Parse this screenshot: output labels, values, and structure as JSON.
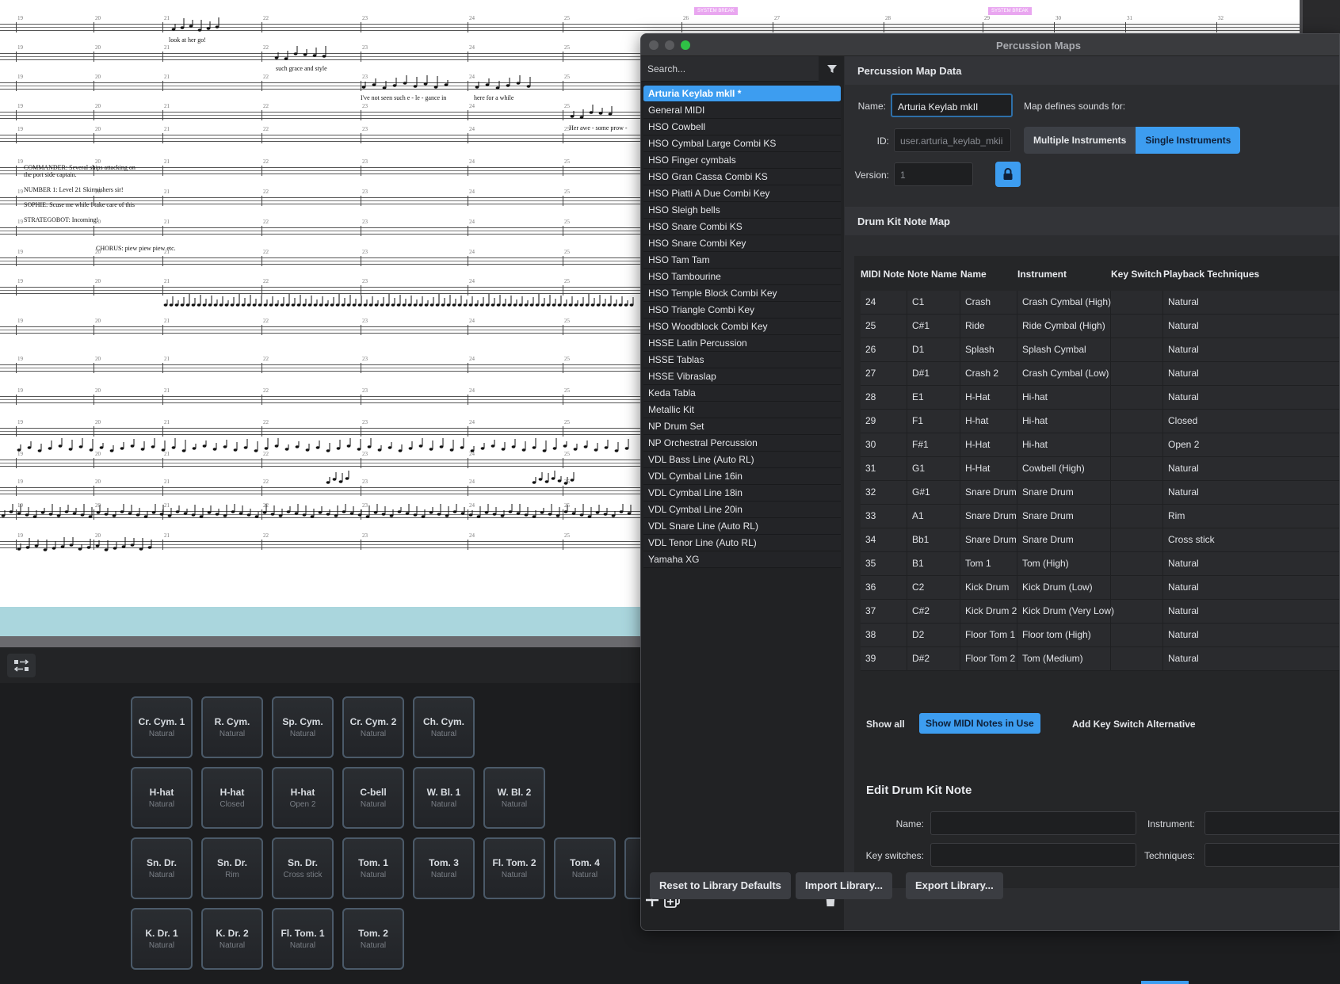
{
  "score": {
    "system_break_label": "SYSTEM BREAK",
    "lyrics": [
      "look at her go!",
      "such grace and style",
      "I've not seen such e - le - gance in",
      "here for a while",
      "Her awe - some prow -",
      "COMMANDER: Several ships attacking on",
      "the port side captain.",
      "NUMBER 1: Level 21 Skirmishers sir!",
      "SOPHIE: Scuse me while I take care of this",
      "STRATEGOBOT: Incoming!",
      "CHORUS: piew piew piew etc."
    ],
    "bar_numbers": [
      "19",
      "20",
      "21",
      "22",
      "23",
      "24",
      "25",
      "26",
      "27",
      "28",
      "29",
      "30",
      "31",
      "32"
    ]
  },
  "dialog": {
    "title": "Percussion Maps",
    "search_placeholder": "Search...",
    "maps": [
      "Arturia Keylab mkII *",
      "General MIDI",
      "HSO Cowbell",
      "HSO Cymbal Large Combi KS",
      "HSO Finger cymbals",
      "HSO Gran Cassa Combi KS",
      "HSO Piatti A Due Combi Key",
      "HSO Sleigh bells",
      "HSO Snare Combi KS",
      "HSO Snare Combi Key",
      "HSO Tam Tam",
      "HSO Tambourine",
      "HSO Temple Block Combi Key",
      "HSO Triangle Combi Key",
      "HSO Woodblock Combi Key",
      "HSSE Latin Percussion",
      "HSSE Tablas",
      "HSSE Vibraslap",
      "Keda Tabla",
      "Metallic Kit",
      "NP Drum Set",
      "NP Orchestral Percussion",
      "VDL Bass Line (Auto RL)",
      "VDL Cymbal Line 16in",
      "VDL Cymbal Line 18in",
      "VDL Cymbal Line 20in",
      "VDL Snare Line (Auto RL)",
      "VDL Tenor Line (Auto RL)",
      "Yamaha XG"
    ],
    "data_section": {
      "heading": "Percussion Map Data",
      "name_label": "Name:",
      "name_value": "Arturia Keylab mkII",
      "id_label": "ID:",
      "id_value": "user.arturia_keylab_mkii",
      "version_label": "Version:",
      "version_value": "1",
      "defines_label": "Map defines sounds for:",
      "multiple_label": "Multiple Instruments",
      "single_label": "Single Instruments"
    },
    "note_map": {
      "heading": "Drum Kit Note Map",
      "columns": [
        "MIDI Note",
        "Note Name",
        "Name",
        "Instrument",
        "Key Switch",
        "Playback Techniques"
      ],
      "rows": [
        [
          "24",
          "C1",
          "Crash",
          "Crash Cymbal (High)",
          "",
          "Natural"
        ],
        [
          "25",
          "C#1",
          "Ride",
          "Ride Cymbal (High)",
          "",
          "Natural"
        ],
        [
          "26",
          "D1",
          "Splash",
          "Splash Cymbal",
          "",
          "Natural"
        ],
        [
          "27",
          "D#1",
          "Crash 2",
          "Crash Cymbal (Low)",
          "",
          "Natural"
        ],
        [
          "28",
          "E1",
          "H-Hat",
          "Hi-hat",
          "",
          "Natural"
        ],
        [
          "29",
          "F1",
          "H-hat",
          "Hi-hat",
          "",
          "Closed"
        ],
        [
          "30",
          "F#1",
          "H-Hat",
          "Hi-hat",
          "",
          "Open 2"
        ],
        [
          "31",
          "G1",
          "H-Hat",
          "Cowbell (High)",
          "",
          "Natural"
        ],
        [
          "32",
          "G#1",
          "Snare Drum",
          "Snare Drum",
          "",
          "Natural"
        ],
        [
          "33",
          "A1",
          "Snare Drum",
          "Snare Drum",
          "",
          "Rim"
        ],
        [
          "34",
          "Bb1",
          "Snare Drum",
          "Snare Drum",
          "",
          "Cross stick"
        ],
        [
          "35",
          "B1",
          "Tom 1",
          "Tom (High)",
          "",
          "Natural"
        ],
        [
          "36",
          "C2",
          "Kick Drum",
          "Kick Drum (Low)",
          "",
          "Natural"
        ],
        [
          "37",
          "C#2",
          "Kick Drum 2",
          "Kick Drum (Very Low)",
          "",
          "Natural"
        ],
        [
          "38",
          "D2",
          "Floor Tom 1",
          "Floor tom (High)",
          "",
          "Natural"
        ],
        [
          "39",
          "D#2",
          "Floor Tom 2",
          "Tom (Medium)",
          "",
          "Natural"
        ]
      ],
      "show_all": "Show all",
      "show_in_use": "Show MIDI Notes in Use",
      "add_key_switch": "Add Key Switch Alternative"
    },
    "edit_section": {
      "heading": "Edit Drum Kit Note",
      "name_label": "Name:",
      "instrument_label": "Instrument:",
      "key_switches_label": "Key switches:",
      "techniques_label": "Techniques:"
    },
    "buttons": {
      "reset": "Reset to Library Defaults",
      "import": "Import Library...",
      "export": "Export Library..."
    }
  },
  "pads": [
    {
      "label": "Cr. Cym. 1",
      "tech": "Natural"
    },
    {
      "label": "R. Cym.",
      "tech": "Natural"
    },
    {
      "label": "Sp. Cym.",
      "tech": "Natural"
    },
    {
      "label": "Cr. Cym. 2",
      "tech": "Natural"
    },
    {
      "label": "Ch. Cym.",
      "tech": "Natural"
    },
    {
      "label": "H-hat",
      "tech": "Natural"
    },
    {
      "label": "H-hat",
      "tech": "Closed"
    },
    {
      "label": "H-hat",
      "tech": "Open 2"
    },
    {
      "label": "C-bell",
      "tech": "Natural"
    },
    {
      "label": "W. Bl. 1",
      "tech": "Natural"
    },
    {
      "label": "W. Bl. 2",
      "tech": "Natural"
    },
    {
      "label": "Sn. Dr.",
      "tech": "Natural"
    },
    {
      "label": "Sn. Dr.",
      "tech": "Rim"
    },
    {
      "label": "Sn. Dr.",
      "tech": "Cross stick"
    },
    {
      "label": "Tom. 1",
      "tech": "Natural"
    },
    {
      "label": "Tom. 3",
      "tech": "Natural"
    },
    {
      "label": "Fl. Tom. 2",
      "tech": "Natural"
    },
    {
      "label": "Tom. 4",
      "tech": "Natural"
    },
    {
      "label": "K. Dr. 1",
      "tech": "Natural"
    },
    {
      "label": "K. Dr. 2",
      "tech": "Natural"
    },
    {
      "label": "Fl. Tom. 1",
      "tech": "Natural"
    },
    {
      "label": "Tom. 2",
      "tech": "Natural"
    }
  ],
  "colors": {
    "accent": "#3d9df0",
    "system_break": "#e9a6f0",
    "footer_band": "#aad6dd"
  }
}
